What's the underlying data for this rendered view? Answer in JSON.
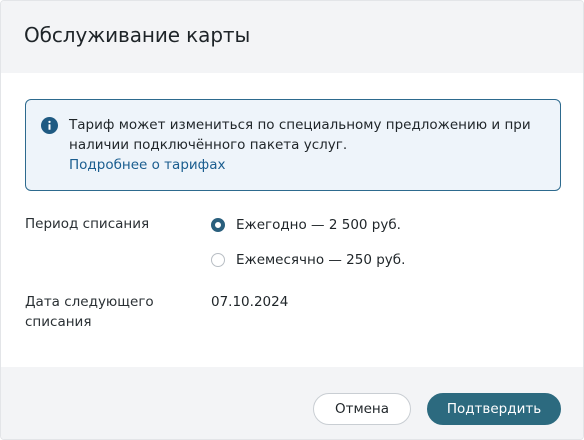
{
  "dialog": {
    "title": "Обслуживание карты"
  },
  "info": {
    "icon": "info-icon",
    "text": "Тариф может измениться по специальному предложению и при наличии подключённого пакета услуг.",
    "link_label": "Подробнее о тарифах"
  },
  "period": {
    "label": "Период списания",
    "options": [
      {
        "label": "Ежегодно — 2 500 руб.",
        "selected": true
      },
      {
        "label": "Ежемесячно — 250 руб.",
        "selected": false
      }
    ]
  },
  "next_charge": {
    "label": "Дата следующего списания",
    "value": "07.10.2024"
  },
  "actions": {
    "cancel_label": "Отмена",
    "confirm_label": "Подтвердить"
  },
  "colors": {
    "accent": "#2c6a7f",
    "link": "#1a5d8f",
    "info_border": "#2d6a8e",
    "info_background": "#eef4fa"
  }
}
